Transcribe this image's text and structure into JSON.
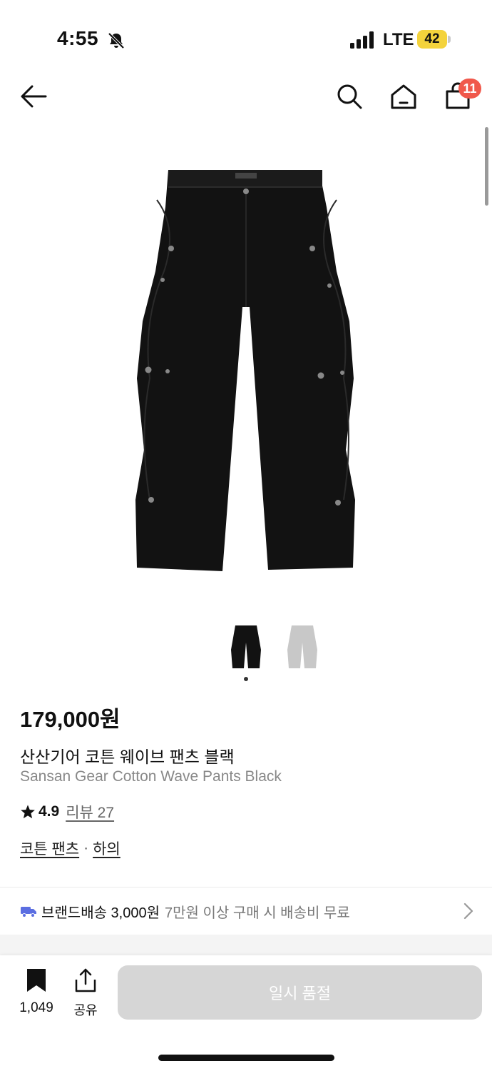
{
  "status_bar": {
    "time": "4:55",
    "network": "LTE",
    "battery": "42",
    "battery_color": "#f4d33c"
  },
  "nav": {
    "back_icon": "arrow-left-icon",
    "search_icon": "search-icon",
    "home_icon": "home-icon",
    "cart_icon": "shopping-bag-icon",
    "cart_badge": "11",
    "badge_color": "#f0584b"
  },
  "product": {
    "price": "179,000원",
    "name_kr": "산산기어 코튼 웨이브 팬츠 블랙",
    "name_en": "Sansan Gear Cotton Wave Pants Black",
    "rating": "4.9",
    "review_label": "리뷰 27",
    "categories": [
      "코튼 팬츠",
      "하의"
    ],
    "category_separator": "·",
    "thumbnails": [
      "black-variant",
      "light-grey-variant"
    ]
  },
  "shipping": {
    "label": "브랜드배송 3,000원",
    "description": "7만원 이상 구매 시 배송비 무료"
  },
  "bottom_bar": {
    "bookmark_count": "1,049",
    "share_label": "공유",
    "button_label": "일시 품절",
    "button_color": "#d6d6d6"
  }
}
